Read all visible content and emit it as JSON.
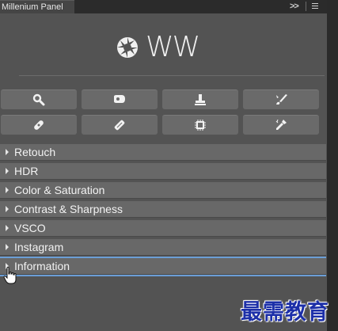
{
  "panel": {
    "tab_title": "Millenium Panel",
    "expand_label": ">>",
    "logo_text": "WW"
  },
  "tools": [
    {
      "name": "search-icon"
    },
    {
      "name": "eraser-icon"
    },
    {
      "name": "stamp-icon"
    },
    {
      "name": "brush-icon"
    },
    {
      "name": "bandage-icon"
    },
    {
      "name": "healing-brush-icon"
    },
    {
      "name": "chip-icon"
    },
    {
      "name": "eyedropper-icon"
    }
  ],
  "sections": [
    {
      "label": "Retouch"
    },
    {
      "label": "HDR"
    },
    {
      "label": "Color & Saturation"
    },
    {
      "label": "Contrast & Sharpness"
    },
    {
      "label": "VSCO"
    },
    {
      "label": "Instagram"
    },
    {
      "label": "Information"
    }
  ],
  "colors": {
    "panel_bg": "#535353",
    "row_bg": "#686868",
    "button_bg": "#6a6a6a",
    "active_accent": "#6b9ed6",
    "watermark": "#1c2fa8"
  },
  "watermark_text": "最需教育"
}
